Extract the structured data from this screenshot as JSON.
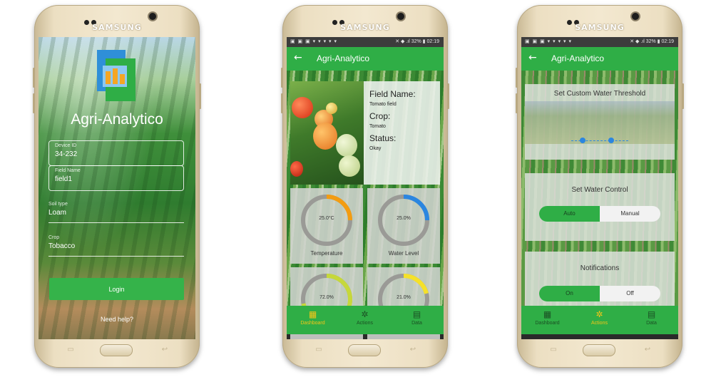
{
  "phones": [
    {
      "brand": "SAMSUNG"
    },
    {
      "brand": "SAMSUNG"
    },
    {
      "brand": "SAMSUNG"
    }
  ],
  "login": {
    "app_name": "Agri-Analytico",
    "device_id_label": "Device ID",
    "device_id_value": "34-232",
    "field_name_label": "Field Name",
    "field_name_value": "field1",
    "soil_type_label": "Soil type",
    "soil_type_value": "Loam",
    "crop_label": "Crop",
    "crop_value": "Tobacco",
    "login_button": "Login",
    "help_link": "Need help?"
  },
  "status": {
    "left_icons": "▣ ▣ ▣ ▾ ▾ ▾ ▾ ▾",
    "right_dashboard": "✕ ◆ .ıl 32% ▮ 02:19",
    "right_actions": "✕ ◆ .ıl 32% ▮ 02:19"
  },
  "appbar": {
    "back_icon": "arrow-left-icon",
    "back_glyph": "←",
    "title": "Agri-Analytico"
  },
  "dashboard": {
    "field_name_key": "Field Name:",
    "field_name_value": "Tomato field",
    "crop_key": "Crop:",
    "crop_value": "Tomato",
    "status_key": "Status:",
    "status_value": "Okay",
    "gauges": [
      {
        "label": "Temperature",
        "value": "25.0°C",
        "fraction": 0.25,
        "color": "#f39c12"
      },
      {
        "label": "Water Level",
        "value": "25.0%",
        "fraction": 0.25,
        "color": "#2b86e0"
      },
      {
        "label": "",
        "value": "72.0%",
        "fraction": 0.72,
        "color": "#c6d83a"
      },
      {
        "label": "",
        "value": "21.0%",
        "fraction": 0.21,
        "color": "#f5e12a"
      }
    ]
  },
  "actions": {
    "threshold_title": "Set Custom Water Threshold",
    "threshold_range": [
      0.2,
      0.7
    ],
    "water_control_title": "Set Water Control",
    "water_control_options": [
      "Auto",
      "Manual"
    ],
    "water_control_selected": "Auto",
    "notifications_title": "Notifications",
    "notification_options": [
      "On",
      "Off"
    ],
    "notification_selected": "On"
  },
  "bottom_nav": {
    "items": [
      {
        "label": "Dashboard",
        "icon": "dashboard-icon",
        "glyph": "▦"
      },
      {
        "label": "Actions",
        "icon": "gear-icon",
        "glyph": "✲"
      },
      {
        "label": "Data",
        "icon": "library-books-icon",
        "glyph": "▤"
      }
    ]
  },
  "colors": {
    "primary_green": "#2fae46",
    "login_button": "#35b34a",
    "active_nav": "#f5c518",
    "nav_text": "#1b4f24"
  }
}
